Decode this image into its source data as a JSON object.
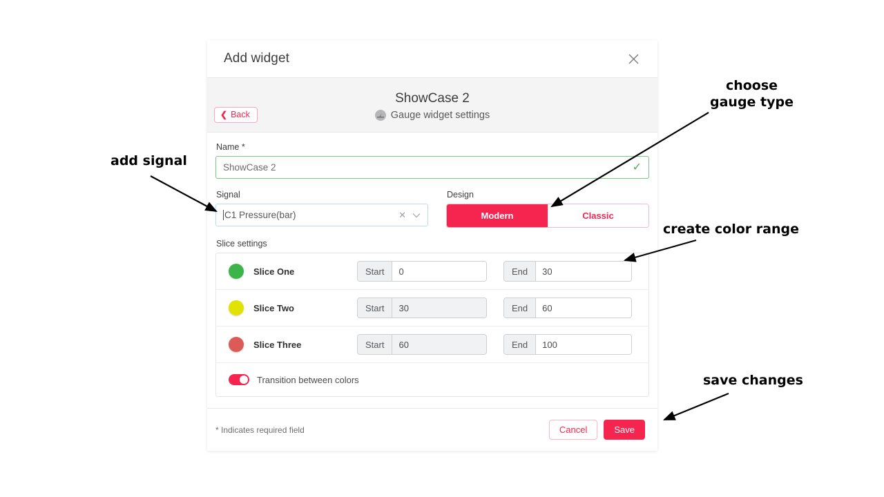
{
  "dialog": {
    "title": "Add widget",
    "close_icon": "close-icon",
    "back_label": "Back",
    "back_icon": "chevron-left-icon",
    "widget_title": "ShowCase 2",
    "widget_subtitle": "Gauge widget settings",
    "gauge_icon": "gauge-icon"
  },
  "form": {
    "name_label": "Name *",
    "name_value": "ShowCase 2",
    "name_valid_icon": "check-icon",
    "signal_label": "Signal",
    "signal_value": "C1 Pressure(bar)",
    "signal_clear_icon": "close-small-icon",
    "signal_caret_icon": "chevron-down-icon",
    "design_label": "Design",
    "design_options": [
      {
        "label": "Modern",
        "selected": true
      },
      {
        "label": "Classic",
        "selected": false
      }
    ]
  },
  "slice_settings": {
    "heading": "Slice settings",
    "start_label": "Start",
    "end_label": "End",
    "rows": [
      {
        "name": "Slice One",
        "color": "#3bb54a",
        "start": "0",
        "end": "30",
        "start_disabled": false
      },
      {
        "name": "Slice Two",
        "color": "#e2e200",
        "start": "30",
        "end": "60",
        "start_disabled": true
      },
      {
        "name": "Slice Three",
        "color": "#dd5b57",
        "start": "60",
        "end": "100",
        "start_disabled": true
      }
    ],
    "transition_label": "Transition between colors",
    "transition_on": true
  },
  "footer": {
    "required_note": "* Indicates required field",
    "cancel_label": "Cancel",
    "save_label": "Save"
  },
  "annotations": {
    "add_signal": "add signal",
    "gauge_type": "choose\ngauge type",
    "color_range": "create color range",
    "save_changes": "save changes"
  },
  "colors": {
    "accent": "#f5254f",
    "valid_green": "#4bad52",
    "header_grey": "#f4f4f5"
  }
}
